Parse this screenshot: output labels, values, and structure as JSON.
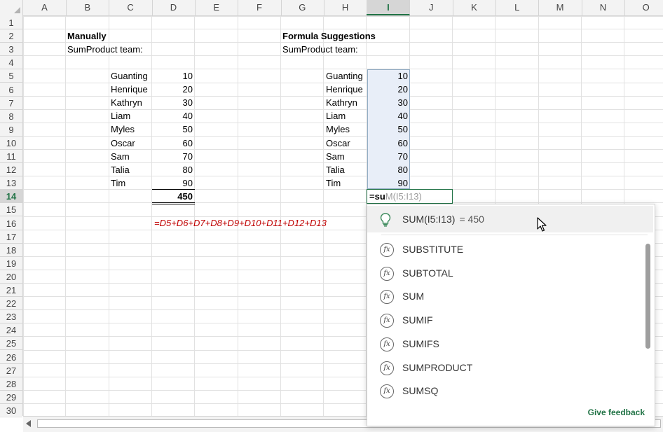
{
  "columns": [
    "A",
    "B",
    "C",
    "D",
    "E",
    "F",
    "G",
    "H",
    "I",
    "J",
    "K",
    "L",
    "M",
    "N",
    "O"
  ],
  "rows": [
    "1",
    "2",
    "3",
    "4",
    "5",
    "6",
    "7",
    "8",
    "9",
    "10",
    "11",
    "12",
    "13",
    "14",
    "15",
    "16",
    "17",
    "18",
    "19",
    "20",
    "21",
    "22",
    "23",
    "24",
    "25",
    "26",
    "27",
    "28",
    "29",
    "30"
  ],
  "selected_column": "I",
  "selected_row": "14",
  "left_block": {
    "heading": "Manually",
    "team_label": "SumProduct team:",
    "names": [
      "Guanting",
      "Henrique",
      "Kathryn",
      "Liam",
      "Myles",
      "Oscar",
      "Sam",
      "Talia",
      "Tim"
    ],
    "values": [
      "10",
      "20",
      "30",
      "40",
      "50",
      "60",
      "70",
      "80",
      "90"
    ],
    "total": "450",
    "formula": "=D5+D6+D7+D8+D9+D10+D11+D12+D13"
  },
  "right_block": {
    "heading": "Formula Suggestions",
    "team_label": "SumProduct team:",
    "names": [
      "Guanting",
      "Henrique",
      "Kathryn",
      "Liam",
      "Myles",
      "Oscar",
      "Sam",
      "Talia",
      "Tim"
    ],
    "values": [
      "10",
      "20",
      "30",
      "40",
      "50",
      "60",
      "70",
      "80",
      "90"
    ],
    "typed": "=su",
    "ghost": "M(I5:I13)"
  },
  "popup": {
    "suggestion_formula": "SUM(I5:I13)",
    "suggestion_result": "= 450",
    "functions": [
      "SUBSTITUTE",
      "SUBTOTAL",
      "SUM",
      "SUMIF",
      "SUMIFS",
      "SUMPRODUCT",
      "SUMSQ"
    ],
    "feedback": "Give feedback",
    "fx_glyph": "fx"
  },
  "colors": {
    "accent": "#217346",
    "formula_red": "#c00000",
    "selection_fill": "#e8eef8"
  }
}
